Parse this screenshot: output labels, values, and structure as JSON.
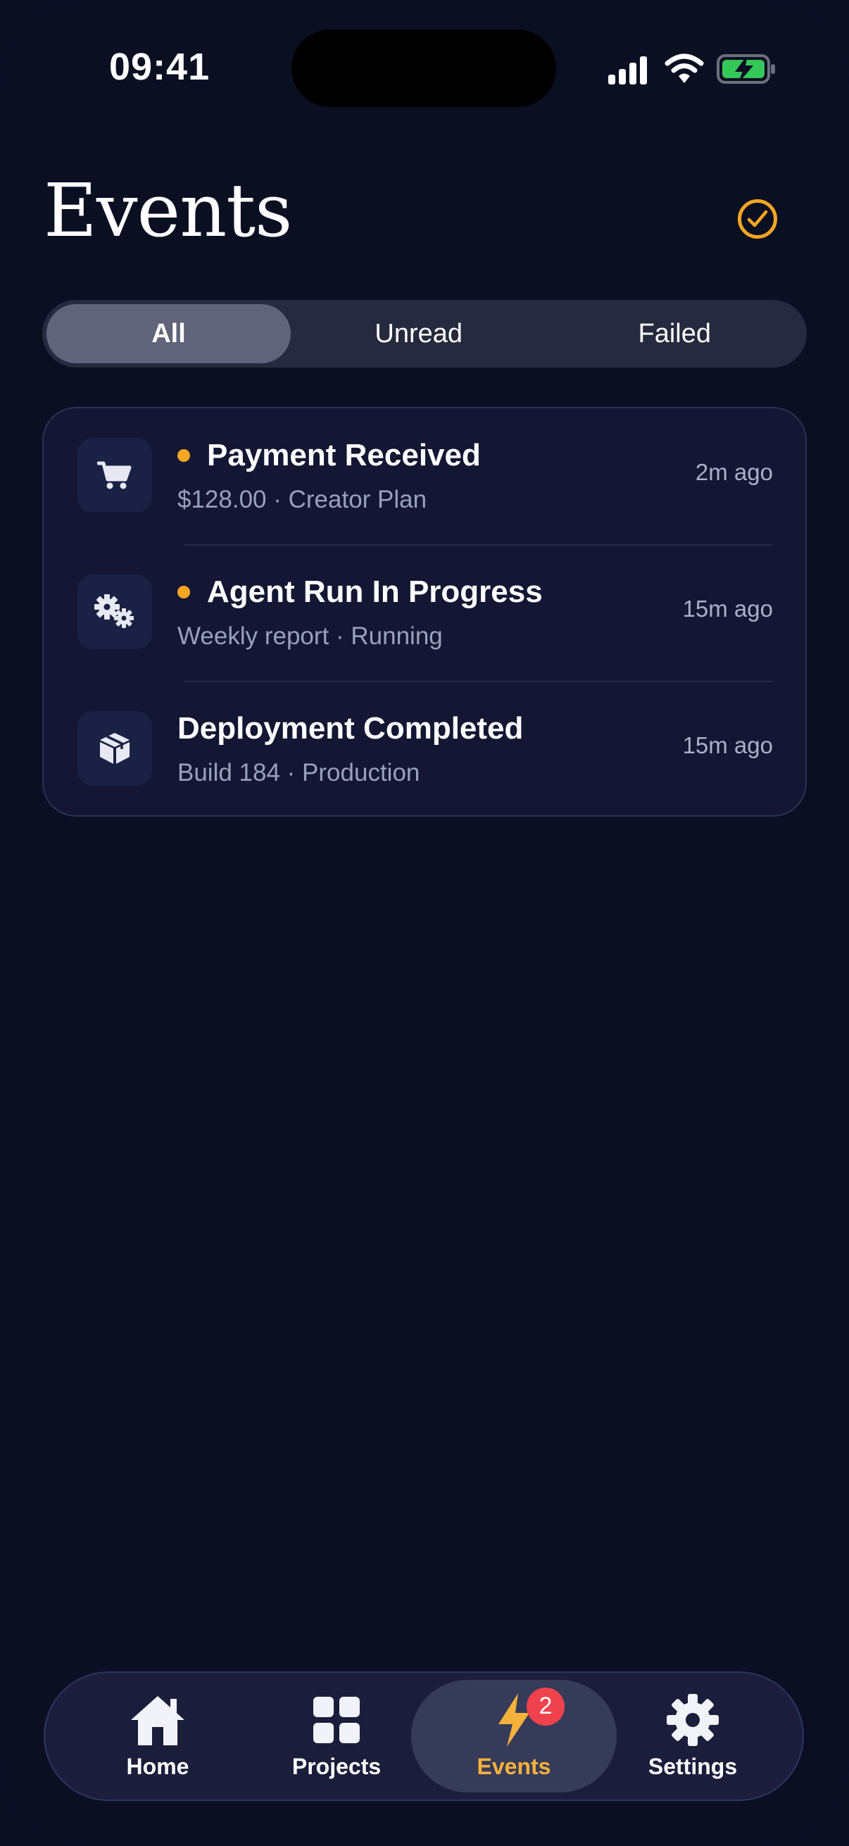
{
  "status_bar": {
    "time": "09:41"
  },
  "header": {
    "title": "Events",
    "mark_all_read_icon": "check-circle-icon"
  },
  "filters": [
    {
      "label": "All",
      "active": true
    },
    {
      "label": "Unread",
      "active": false
    },
    {
      "label": "Failed",
      "active": false
    }
  ],
  "events": [
    {
      "icon": "cart-icon",
      "unread": true,
      "title": "Payment Received",
      "subtitle": "$128.00 · Creator Plan",
      "time": "2m ago"
    },
    {
      "icon": "gears-icon",
      "unread": true,
      "title": "Agent Run In Progress",
      "subtitle": "Weekly report · Running",
      "time": "15m ago"
    },
    {
      "icon": "cube-icon",
      "unread": false,
      "title": "Deployment Completed",
      "subtitle": "Build 184 · Production",
      "time": "15m ago"
    }
  ],
  "tab_bar": {
    "tabs": [
      {
        "label": "Home",
        "icon": "home-icon",
        "active": false
      },
      {
        "label": "Projects",
        "icon": "grid-icon",
        "active": false
      },
      {
        "label": "Events",
        "icon": "bolt-icon",
        "active": true,
        "badge": "2"
      },
      {
        "label": "Settings",
        "icon": "gear-icon",
        "active": false
      }
    ]
  },
  "colors": {
    "accent": "#f5a623",
    "background": "#0b0f22",
    "badge": "#f0424c",
    "battery": "#34c759"
  }
}
